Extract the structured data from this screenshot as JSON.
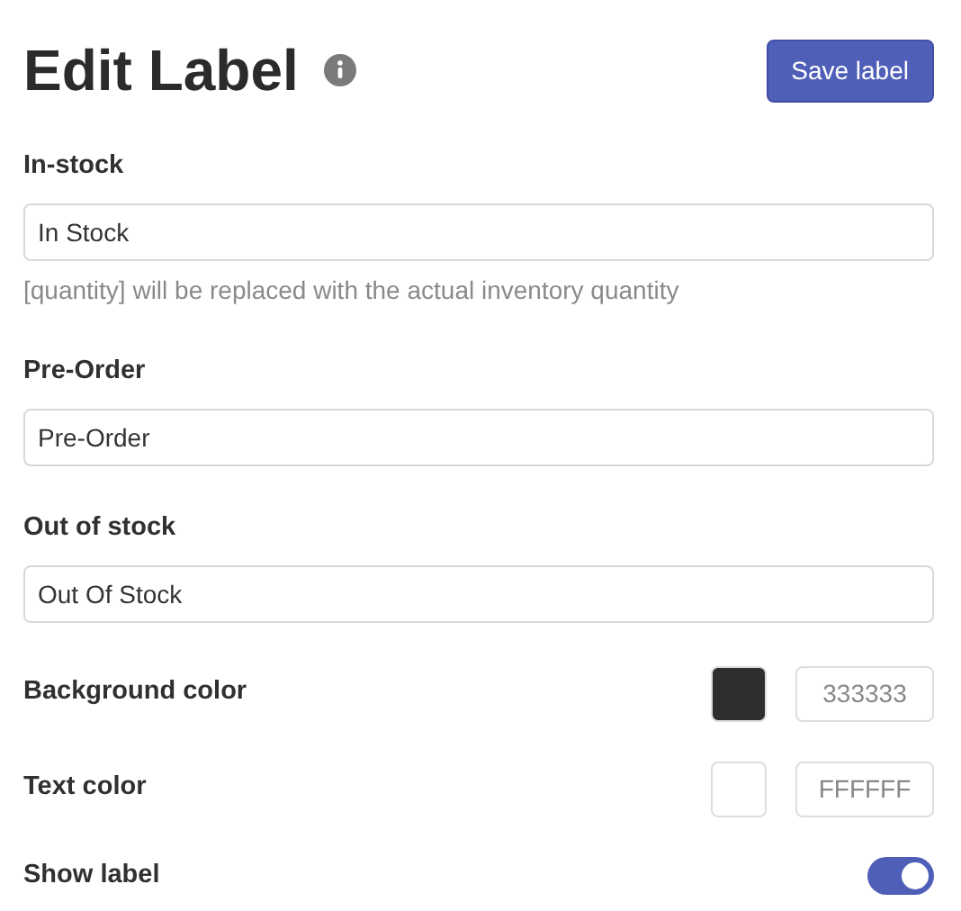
{
  "header": {
    "title": "Edit Label",
    "save_button": "Save label"
  },
  "text_fields": [
    {
      "label": "In-stock",
      "value": "In Stock",
      "help": "[quantity] will be replaced with the actual inventory quantity"
    },
    {
      "label": "Pre-Order",
      "value": "Pre-Order"
    },
    {
      "label": "Out of stock",
      "value": "Out Of Stock"
    }
  ],
  "color_fields": [
    {
      "label": "Background color",
      "color": "#2e2e2e",
      "placeholder": "333333"
    },
    {
      "label": "Text color",
      "color": "#ffffff",
      "placeholder": "FFFFFF"
    }
  ],
  "show_label": {
    "label": "Show label",
    "on": true
  }
}
